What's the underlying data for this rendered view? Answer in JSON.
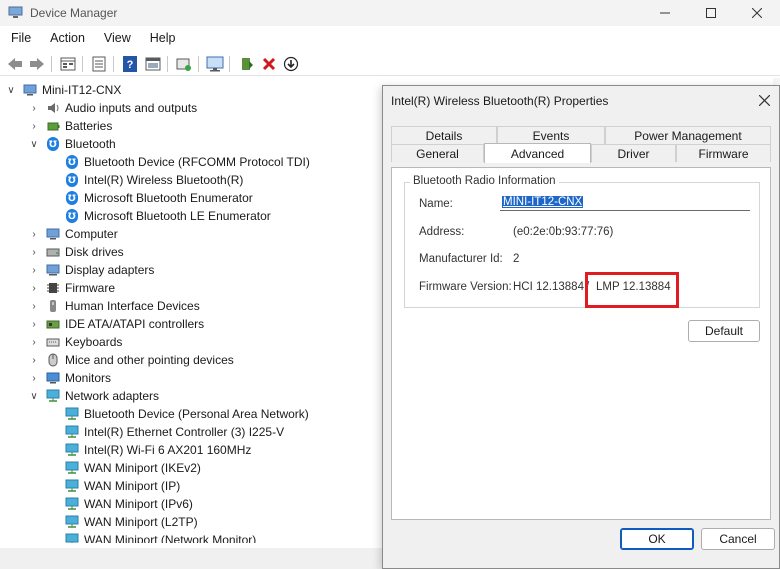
{
  "window": {
    "title": "Device Manager"
  },
  "menu": [
    "File",
    "Action",
    "View",
    "Help"
  ],
  "toolbar": [
    "back-icon",
    "forward-icon",
    "properties-grid-icon",
    "details-icon",
    "help-icon",
    "show-hidden-icon",
    "scan-hardware-icon",
    "monitor-icon",
    "update-driver-icon",
    "uninstall-icon",
    "disable-icon"
  ],
  "tree": {
    "root": "Mini-IT12-CNX",
    "items": [
      {
        "label": "Audio inputs and outputs",
        "icon": "speaker-icon",
        "state": "collapsed"
      },
      {
        "label": "Batteries",
        "icon": "battery-icon",
        "state": "collapsed"
      },
      {
        "label": "Bluetooth",
        "icon": "bluetooth-icon",
        "state": "expanded"
      },
      {
        "label": "Bluetooth Device (RFCOMM Protocol TDI)",
        "icon": "bluetooth-icon",
        "child": true
      },
      {
        "label": "Intel(R) Wireless Bluetooth(R)",
        "icon": "bluetooth-icon",
        "child": true
      },
      {
        "label": "Microsoft Bluetooth Enumerator",
        "icon": "bluetooth-icon",
        "child": true
      },
      {
        "label": "Microsoft Bluetooth LE Enumerator",
        "icon": "bluetooth-icon",
        "child": true
      },
      {
        "label": "Computer",
        "icon": "computer-icon",
        "state": "collapsed"
      },
      {
        "label": "Disk drives",
        "icon": "disk-drive-icon",
        "state": "collapsed"
      },
      {
        "label": "Display adapters",
        "icon": "display-adapter-icon",
        "state": "collapsed"
      },
      {
        "label": "Firmware",
        "icon": "firmware-icon",
        "state": "collapsed"
      },
      {
        "label": "Human Interface Devices",
        "icon": "hid-icon",
        "state": "collapsed"
      },
      {
        "label": "IDE ATA/ATAPI controllers",
        "icon": "ide-controller-icon",
        "state": "collapsed"
      },
      {
        "label": "Keyboards",
        "icon": "keyboard-icon",
        "state": "collapsed"
      },
      {
        "label": "Mice and other pointing devices",
        "icon": "mouse-icon",
        "state": "collapsed"
      },
      {
        "label": "Monitors",
        "icon": "monitor-icon",
        "state": "collapsed"
      },
      {
        "label": "Network adapters",
        "icon": "network-adapter-icon",
        "state": "expanded"
      },
      {
        "label": "Bluetooth Device (Personal Area Network)",
        "icon": "network-adapter-icon",
        "child": true
      },
      {
        "label": "Intel(R) Ethernet Controller (3) I225-V",
        "icon": "network-adapter-icon",
        "child": true
      },
      {
        "label": "Intel(R) Wi-Fi 6 AX201 160MHz",
        "icon": "network-adapter-icon",
        "child": true
      },
      {
        "label": "WAN Miniport (IKEv2)",
        "icon": "network-adapter-icon",
        "child": true
      },
      {
        "label": "WAN Miniport (IP)",
        "icon": "network-adapter-icon",
        "child": true
      },
      {
        "label": "WAN Miniport (IPv6)",
        "icon": "network-adapter-icon",
        "child": true
      },
      {
        "label": "WAN Miniport (L2TP)",
        "icon": "network-adapter-icon",
        "child": true
      },
      {
        "label": "WAN Miniport (Network Monitor)",
        "icon": "network-adapter-icon",
        "child": true
      }
    ]
  },
  "dialog": {
    "title": "Intel(R) Wireless Bluetooth(R) Properties",
    "tabs_back": [
      "Details",
      "Events",
      "Power Management"
    ],
    "tabs_front": [
      "General",
      "Advanced",
      "Driver",
      "Firmware"
    ],
    "active_tab": "Advanced",
    "group_title": "Bluetooth Radio Information",
    "fields": {
      "name_label": "Name:",
      "name_value": "MINI-IT12-CNX",
      "address_label": "Address:",
      "address_value": "(e0:2e:0b:93:77:76)",
      "manufacturer_label": "Manufacturer Id:",
      "manufacturer_value": "2",
      "firmware_label": "Firmware Version:",
      "firmware_hci": "HCI 12.13884",
      "firmware_sep": "/",
      "firmware_lmp": "LMP 12.13884"
    },
    "default_button": "Default",
    "ok_button": "OK",
    "cancel_button": "Cancel"
  },
  "colors": {
    "accent": "#1e66c8",
    "highlight": "#e01b22",
    "bluetooth": "#1d7fe0"
  }
}
